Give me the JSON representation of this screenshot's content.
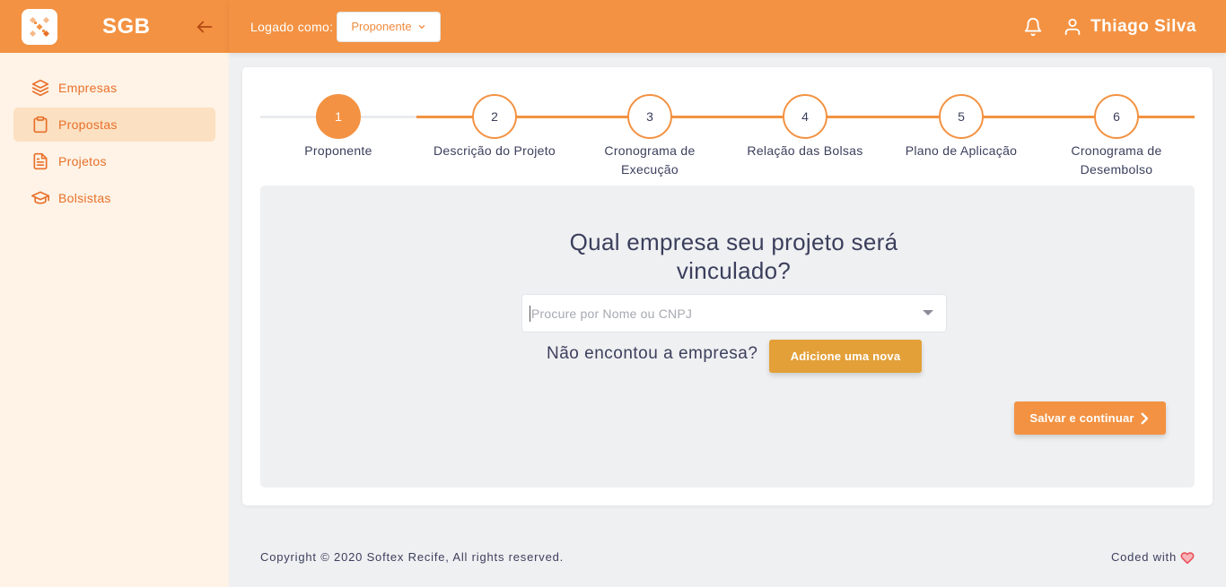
{
  "sidebar": {
    "brand": "SGB",
    "items": [
      {
        "label": "Empresas",
        "icon": "layers-icon",
        "active": false
      },
      {
        "label": "Propostas",
        "icon": "clipboard-icon",
        "active": true
      },
      {
        "label": "Projetos",
        "icon": "file-text-icon",
        "active": false
      },
      {
        "label": "Bolsistas",
        "icon": "graduation-cap-icon",
        "active": false
      }
    ]
  },
  "header": {
    "logged_label": "Logado como:",
    "role": "Proponente",
    "user_name": "Thiago Silva"
  },
  "stepper": {
    "steps": [
      {
        "number": "1",
        "label": "Proponente",
        "active": true
      },
      {
        "number": "2",
        "label": "Descrição do Projeto",
        "active": false
      },
      {
        "number": "3",
        "label": "Cronograma de Execução",
        "active": false
      },
      {
        "number": "4",
        "label": "Relação das Bolsas",
        "active": false
      },
      {
        "number": "5",
        "label": "Plano de Aplicação",
        "active": false
      },
      {
        "number": "6",
        "label": "Cronograma de Desembolso",
        "active": false
      }
    ]
  },
  "form": {
    "question": "Qual empresa seu projeto será vinculado?",
    "search_placeholder": "Procure por Nome ou CNPJ",
    "not_found_text": "Não encontou a empresa?",
    "add_button": "Adicione uma nova",
    "save_button": "Salvar e continuar"
  },
  "footer": {
    "copyright": "Copyright © 2020 Softex Recife, All rights reserved.",
    "coded_with": "Coded with"
  },
  "colors": {
    "primary": "#f39242",
    "sidebar_bg": "#fef3e6",
    "active_item_bg": "#fce0c2",
    "add_button": "#e3a039",
    "text_dark": "#3b3f5c"
  }
}
